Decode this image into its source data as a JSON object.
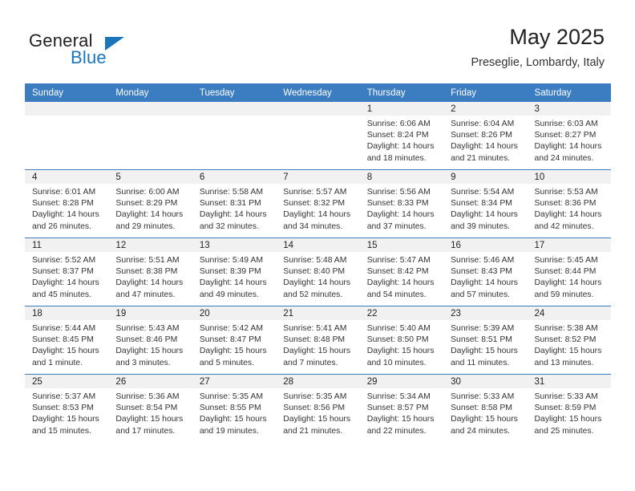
{
  "branding": {
    "name_top": "General",
    "name_bottom": "Blue",
    "accent_color": "#1b75bb"
  },
  "header": {
    "title": "May 2025",
    "subtitle": "Preseglie, Lombardy, Italy"
  },
  "theme": {
    "header_row_color": "#3b7dc0",
    "daynum_band_color": "#f1f1f1",
    "text_color": "#333333"
  },
  "weekday_headers": [
    "Sunday",
    "Monday",
    "Tuesday",
    "Wednesday",
    "Thursday",
    "Friday",
    "Saturday"
  ],
  "weeks": [
    [
      {
        "day": "",
        "sunrise": "",
        "sunset": "",
        "daylight": "",
        "daylight2": ""
      },
      {
        "day": "",
        "sunrise": "",
        "sunset": "",
        "daylight": "",
        "daylight2": ""
      },
      {
        "day": "",
        "sunrise": "",
        "sunset": "",
        "daylight": "",
        "daylight2": ""
      },
      {
        "day": "",
        "sunrise": "",
        "sunset": "",
        "daylight": "",
        "daylight2": ""
      },
      {
        "day": "1",
        "sunrise": "Sunrise: 6:06 AM",
        "sunset": "Sunset: 8:24 PM",
        "daylight": "Daylight: 14 hours",
        "daylight2": "and 18 minutes."
      },
      {
        "day": "2",
        "sunrise": "Sunrise: 6:04 AM",
        "sunset": "Sunset: 8:26 PM",
        "daylight": "Daylight: 14 hours",
        "daylight2": "and 21 minutes."
      },
      {
        "day": "3",
        "sunrise": "Sunrise: 6:03 AM",
        "sunset": "Sunset: 8:27 PM",
        "daylight": "Daylight: 14 hours",
        "daylight2": "and 24 minutes."
      }
    ],
    [
      {
        "day": "4",
        "sunrise": "Sunrise: 6:01 AM",
        "sunset": "Sunset: 8:28 PM",
        "daylight": "Daylight: 14 hours",
        "daylight2": "and 26 minutes."
      },
      {
        "day": "5",
        "sunrise": "Sunrise: 6:00 AM",
        "sunset": "Sunset: 8:29 PM",
        "daylight": "Daylight: 14 hours",
        "daylight2": "and 29 minutes."
      },
      {
        "day": "6",
        "sunrise": "Sunrise: 5:58 AM",
        "sunset": "Sunset: 8:31 PM",
        "daylight": "Daylight: 14 hours",
        "daylight2": "and 32 minutes."
      },
      {
        "day": "7",
        "sunrise": "Sunrise: 5:57 AM",
        "sunset": "Sunset: 8:32 PM",
        "daylight": "Daylight: 14 hours",
        "daylight2": "and 34 minutes."
      },
      {
        "day": "8",
        "sunrise": "Sunrise: 5:56 AM",
        "sunset": "Sunset: 8:33 PM",
        "daylight": "Daylight: 14 hours",
        "daylight2": "and 37 minutes."
      },
      {
        "day": "9",
        "sunrise": "Sunrise: 5:54 AM",
        "sunset": "Sunset: 8:34 PM",
        "daylight": "Daylight: 14 hours",
        "daylight2": "and 39 minutes."
      },
      {
        "day": "10",
        "sunrise": "Sunrise: 5:53 AM",
        "sunset": "Sunset: 8:36 PM",
        "daylight": "Daylight: 14 hours",
        "daylight2": "and 42 minutes."
      }
    ],
    [
      {
        "day": "11",
        "sunrise": "Sunrise: 5:52 AM",
        "sunset": "Sunset: 8:37 PM",
        "daylight": "Daylight: 14 hours",
        "daylight2": "and 45 minutes."
      },
      {
        "day": "12",
        "sunrise": "Sunrise: 5:51 AM",
        "sunset": "Sunset: 8:38 PM",
        "daylight": "Daylight: 14 hours",
        "daylight2": "and 47 minutes."
      },
      {
        "day": "13",
        "sunrise": "Sunrise: 5:49 AM",
        "sunset": "Sunset: 8:39 PM",
        "daylight": "Daylight: 14 hours",
        "daylight2": "and 49 minutes."
      },
      {
        "day": "14",
        "sunrise": "Sunrise: 5:48 AM",
        "sunset": "Sunset: 8:40 PM",
        "daylight": "Daylight: 14 hours",
        "daylight2": "and 52 minutes."
      },
      {
        "day": "15",
        "sunrise": "Sunrise: 5:47 AM",
        "sunset": "Sunset: 8:42 PM",
        "daylight": "Daylight: 14 hours",
        "daylight2": "and 54 minutes."
      },
      {
        "day": "16",
        "sunrise": "Sunrise: 5:46 AM",
        "sunset": "Sunset: 8:43 PM",
        "daylight": "Daylight: 14 hours",
        "daylight2": "and 57 minutes."
      },
      {
        "day": "17",
        "sunrise": "Sunrise: 5:45 AM",
        "sunset": "Sunset: 8:44 PM",
        "daylight": "Daylight: 14 hours",
        "daylight2": "and 59 minutes."
      }
    ],
    [
      {
        "day": "18",
        "sunrise": "Sunrise: 5:44 AM",
        "sunset": "Sunset: 8:45 PM",
        "daylight": "Daylight: 15 hours",
        "daylight2": "and 1 minute."
      },
      {
        "day": "19",
        "sunrise": "Sunrise: 5:43 AM",
        "sunset": "Sunset: 8:46 PM",
        "daylight": "Daylight: 15 hours",
        "daylight2": "and 3 minutes."
      },
      {
        "day": "20",
        "sunrise": "Sunrise: 5:42 AM",
        "sunset": "Sunset: 8:47 PM",
        "daylight": "Daylight: 15 hours",
        "daylight2": "and 5 minutes."
      },
      {
        "day": "21",
        "sunrise": "Sunrise: 5:41 AM",
        "sunset": "Sunset: 8:48 PM",
        "daylight": "Daylight: 15 hours",
        "daylight2": "and 7 minutes."
      },
      {
        "day": "22",
        "sunrise": "Sunrise: 5:40 AM",
        "sunset": "Sunset: 8:50 PM",
        "daylight": "Daylight: 15 hours",
        "daylight2": "and 10 minutes."
      },
      {
        "day": "23",
        "sunrise": "Sunrise: 5:39 AM",
        "sunset": "Sunset: 8:51 PM",
        "daylight": "Daylight: 15 hours",
        "daylight2": "and 11 minutes."
      },
      {
        "day": "24",
        "sunrise": "Sunrise: 5:38 AM",
        "sunset": "Sunset: 8:52 PM",
        "daylight": "Daylight: 15 hours",
        "daylight2": "and 13 minutes."
      }
    ],
    [
      {
        "day": "25",
        "sunrise": "Sunrise: 5:37 AM",
        "sunset": "Sunset: 8:53 PM",
        "daylight": "Daylight: 15 hours",
        "daylight2": "and 15 minutes."
      },
      {
        "day": "26",
        "sunrise": "Sunrise: 5:36 AM",
        "sunset": "Sunset: 8:54 PM",
        "daylight": "Daylight: 15 hours",
        "daylight2": "and 17 minutes."
      },
      {
        "day": "27",
        "sunrise": "Sunrise: 5:35 AM",
        "sunset": "Sunset: 8:55 PM",
        "daylight": "Daylight: 15 hours",
        "daylight2": "and 19 minutes."
      },
      {
        "day": "28",
        "sunrise": "Sunrise: 5:35 AM",
        "sunset": "Sunset: 8:56 PM",
        "daylight": "Daylight: 15 hours",
        "daylight2": "and 21 minutes."
      },
      {
        "day": "29",
        "sunrise": "Sunrise: 5:34 AM",
        "sunset": "Sunset: 8:57 PM",
        "daylight": "Daylight: 15 hours",
        "daylight2": "and 22 minutes."
      },
      {
        "day": "30",
        "sunrise": "Sunrise: 5:33 AM",
        "sunset": "Sunset: 8:58 PM",
        "daylight": "Daylight: 15 hours",
        "daylight2": "and 24 minutes."
      },
      {
        "day": "31",
        "sunrise": "Sunrise: 5:33 AM",
        "sunset": "Sunset: 8:59 PM",
        "daylight": "Daylight: 15 hours",
        "daylight2": "and 25 minutes."
      }
    ]
  ]
}
